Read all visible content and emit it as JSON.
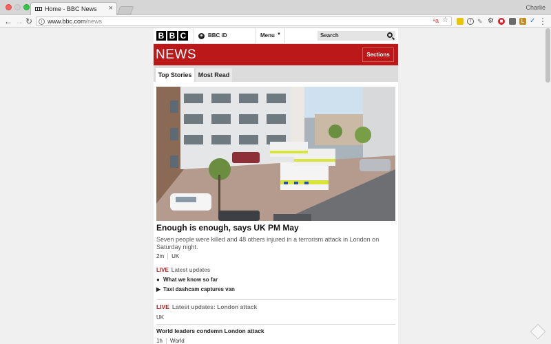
{
  "browser": {
    "tab_title": "Home - BBC News",
    "tab_close": "×",
    "profile_name": "Charlie",
    "url_host": "www.bbc.com",
    "url_path": "/news",
    "nav_back": "←",
    "nav_forward": "→",
    "nav_reload": "↻",
    "star_icon": "☆",
    "menu_icon": "⋮"
  },
  "masthead": {
    "logo_letters": [
      "B",
      "B",
      "C"
    ],
    "bbc_id_label": "BBC iD",
    "menu_label": "Menu",
    "menu_caret": "▼",
    "search_label": "Search"
  },
  "news_band": {
    "title": "NEWS",
    "sections_label": "Sections",
    "color": "#bb1919"
  },
  "tabs": {
    "top_stories": "Top Stories",
    "most_read": "Most Read"
  },
  "lead_story": {
    "headline": "Enough is enough, says UK PM May",
    "summary": "Seven people were killed and 48 others injured in a terrorism attack in London on Saturday night.",
    "time": "2m",
    "section": "UK",
    "live_tag": "LIVE",
    "live_text": "Latest updates",
    "bullets": [
      {
        "icon": "●",
        "text": "What we know so far"
      },
      {
        "icon": "▶",
        "text": "Taxi dashcam captures van"
      }
    ]
  },
  "stories": [
    {
      "live_tag": "LIVE",
      "live_text": "Latest updates: London attack",
      "section": "UK"
    },
    {
      "title": "World leaders condemn London attack",
      "time": "1h",
      "section": "World"
    }
  ]
}
